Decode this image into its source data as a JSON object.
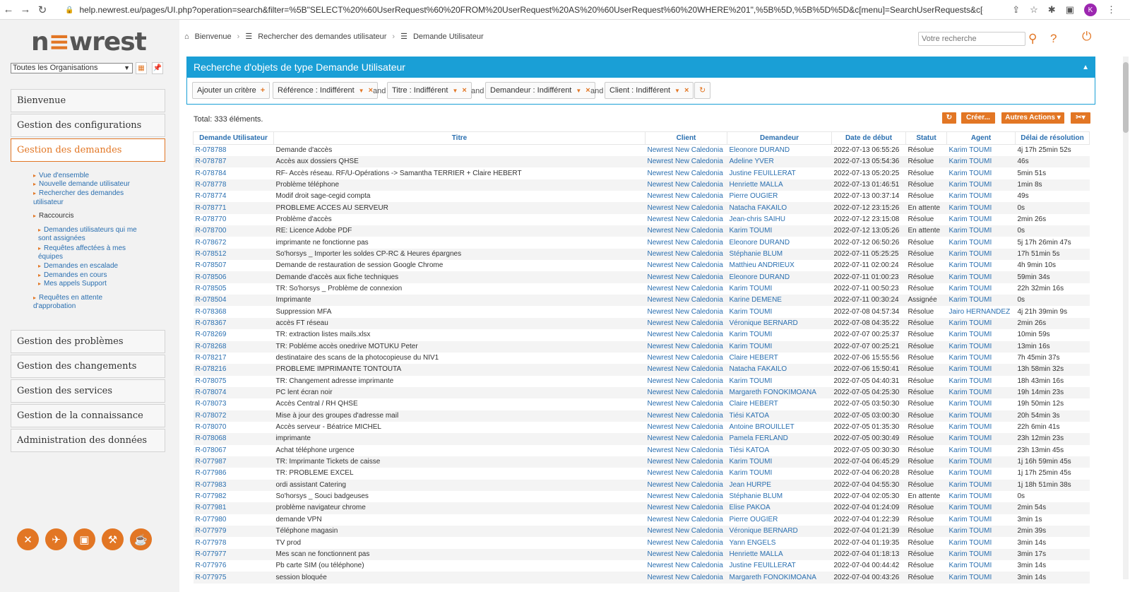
{
  "browser": {
    "url": "help.newrest.eu/pages/UI.php?operation=search&filter=%5B\"SELECT%20%60UserRequest%60%20FROM%20UserRequest%20AS%20%60UserRequest%60%20WHERE%201\",%5B%5D,%5B%5D%5D&c[menu]=SearchUserRequests&c[org_id]=",
    "avatar_letter": "K"
  },
  "logo": {
    "pre": "n",
    "e": "≡",
    "post": "wrest"
  },
  "org_select": "Toutes les Organisations",
  "sidebar": {
    "menus": [
      "Bienvenue",
      "Gestion des configurations",
      "Gestion des demandes",
      "Gestion des problèmes",
      "Gestion des changements",
      "Gestion des services",
      "Gestion de la connaissance",
      "Administration des données"
    ],
    "sub_links": [
      "Vue d'ensemble",
      "Nouvelle demande utilisateur",
      "Rechercher des demandes",
      "utilisateur",
      "Raccourcis",
      "Demandes utilisateurs qui me",
      "sont assignées",
      "Requêtes affectées à mes",
      "équipes",
      "Demandes en escalade",
      "Demandes en cours",
      "Mes appels Support",
      "Requêtes en attente",
      "d'approbation"
    ]
  },
  "breadcrumb": [
    "Bienvenue",
    "Rechercher des demandes utilisateur",
    "Demande Utilisateur"
  ],
  "search": {
    "placeholder": "Votre recherche"
  },
  "panel": {
    "title": "Recherche d'objets de type Demande Utilisateur",
    "add_criteria": "Ajouter un critère",
    "criteria": [
      "Référence : Indifférent",
      "Titre : Indifférent",
      "Demandeur : Indifférent",
      "Client : Indifférent"
    ],
    "and_word": "and"
  },
  "results": {
    "total": "Total: 333 éléments.",
    "create": "Créer...",
    "other_actions": "Autres Actions ▾",
    "columns": [
      "Demande Utilisateur",
      "Titre",
      "Client",
      "Demandeur",
      "Date de début",
      "Statut",
      "Agent",
      "Délai de résolution"
    ],
    "rows": [
      [
        "R-078788",
        "Demande d'accès",
        "Newrest New Caledonia",
        "Eleonore DURAND",
        "2022-07-13 06:55:26",
        "Résolue",
        "Karim TOUMI",
        "4j 17h 25min 52s"
      ],
      [
        "R-078787",
        "Accès aux dossiers QHSE",
        "Newrest New Caledonia",
        "Adeline YVER",
        "2022-07-13 05:54:36",
        "Résolue",
        "Karim TOUMI",
        "46s"
      ],
      [
        "R-078784",
        "RF- Accès réseau. RF/U-Opérations -> Samantha TERRIER + Claire HEBERT",
        "Newrest New Caledonia",
        "Justine FEUILLERAT",
        "2022-07-13 05:20:25",
        "Résolue",
        "Karim TOUMI",
        "5min 51s"
      ],
      [
        "R-078778",
        "Problème téléphone",
        "Newrest New Caledonia",
        "Henriette MALLA",
        "2022-07-13 01:46:51",
        "Résolue",
        "Karim TOUMI",
        "1min 8s"
      ],
      [
        "R-078774",
        "Modif droit sage-cegid compta",
        "Newrest New Caledonia",
        "Pierre OUGIER",
        "2022-07-13 00:37:14",
        "Résolue",
        "Karim TOUMI",
        "49s"
      ],
      [
        "R-078771",
        "PROBLEME ACCES AU SERVEUR",
        "Newrest New Caledonia",
        "Natacha FAKAILO",
        "2022-07-12 23:15:26",
        "En attente",
        "Karim TOUMI",
        "0s"
      ],
      [
        "R-078770",
        "Problème d'accès",
        "Newrest New Caledonia",
        "Jean-chris SAIHU",
        "2022-07-12 23:15:08",
        "Résolue",
        "Karim TOUMI",
        "2min 26s"
      ],
      [
        "R-078700",
        "RE: Licence Adobe PDF",
        "Newrest New Caledonia",
        "Karim TOUMI",
        "2022-07-12 13:05:26",
        "En attente",
        "Karim TOUMI",
        "0s"
      ],
      [
        "R-078672",
        "imprimante ne fonctionne pas",
        "Newrest New Caledonia",
        "Eleonore DURAND",
        "2022-07-12 06:50:26",
        "Résolue",
        "Karim TOUMI",
        "5j 17h 26min 47s"
      ],
      [
        "R-078512",
        "So'horsys _ Importer les soldes CP-RC & Heures épargnes",
        "Newrest New Caledonia",
        "Stéphanie BLUM",
        "2022-07-11 05:25:25",
        "Résolue",
        "Karim TOUMI",
        "17h 51min 5s"
      ],
      [
        "R-078507",
        "Demande de restauration de session Google Chrome",
        "Newrest New Caledonia",
        "Matthieu ANDRIEUX",
        "2022-07-11 02:00:24",
        "Résolue",
        "Karim TOUMI",
        "4h 9min 10s"
      ],
      [
        "R-078506",
        "Demande d'accès aux fiche techniques",
        "Newrest New Caledonia",
        "Eleonore DURAND",
        "2022-07-11 01:00:23",
        "Résolue",
        "Karim TOUMI",
        "59min 34s"
      ],
      [
        "R-078505",
        "TR: So'horsys _ Problème de connexion",
        "Newrest New Caledonia",
        "Karim TOUMI",
        "2022-07-11 00:50:23",
        "Résolue",
        "Karim TOUMI",
        "22h 32min 16s"
      ],
      [
        "R-078504",
        "Imprimante",
        "Newrest New Caledonia",
        "Karine DEMENE",
        "2022-07-11 00:30:24",
        "Assignée",
        "Karim TOUMI",
        "0s"
      ],
      [
        "R-078368",
        "Suppression MFA",
        "Newrest New Caledonia",
        "Karim TOUMI",
        "2022-07-08 04:57:34",
        "Résolue",
        "Jairo HERNANDEZ",
        "4j 21h 39min 9s"
      ],
      [
        "R-078367",
        "accès FT réseau",
        "Newrest New Caledonia",
        "Véronique BERNARD",
        "2022-07-08 04:35:22",
        "Résolue",
        "Karim TOUMI",
        "2min 26s"
      ],
      [
        "R-078269",
        "TR: extraction listes mails.xlsx",
        "Newrest New Caledonia",
        "Karim TOUMI",
        "2022-07-07 00:25:37",
        "Résolue",
        "Karim TOUMI",
        "10min 59s"
      ],
      [
        "R-078268",
        "TR: Pobléme accès onedrive MOTUKU Peter",
        "Newrest New Caledonia",
        "Karim TOUMI",
        "2022-07-07 00:25:21",
        "Résolue",
        "Karim TOUMI",
        "13min 16s"
      ],
      [
        "R-078217",
        "destinataire des scans de la photocopieuse du NIV1",
        "Newrest New Caledonia",
        "Claire HEBERT",
        "2022-07-06 15:55:56",
        "Résolue",
        "Karim TOUMI",
        "7h 45min 37s"
      ],
      [
        "R-078216",
        "PROBLEME IMPRIMANTE TONTOUTA",
        "Newrest New Caledonia",
        "Natacha FAKAILO",
        "2022-07-06 15:50:41",
        "Résolue",
        "Karim TOUMI",
        "13h 58min 32s"
      ],
      [
        "R-078075",
        "TR: Changement adresse imprimante",
        "Newrest New Caledonia",
        "Karim TOUMI",
        "2022-07-05 04:40:31",
        "Résolue",
        "Karim TOUMI",
        "18h 43min 16s"
      ],
      [
        "R-078074",
        "PC lent écran noir",
        "Newrest New Caledonia",
        "Margareth FONOKIMOANA",
        "2022-07-05 04:25:30",
        "Résolue",
        "Karim TOUMI",
        "19h 14min 23s"
      ],
      [
        "R-078073",
        "Accès Central / RH QHSE",
        "Newrest New Caledonia",
        "Claire HEBERT",
        "2022-07-05 03:50:30",
        "Résolue",
        "Karim TOUMI",
        "19h 50min 12s"
      ],
      [
        "R-078072",
        "Mise à jour des groupes d'adresse mail",
        "Newrest New Caledonia",
        "Tiési KATOA",
        "2022-07-05 03:00:30",
        "Résolue",
        "Karim TOUMI",
        "20h 54min 3s"
      ],
      [
        "R-078070",
        "Accès serveur - Béatrice MICHEL",
        "Newrest New Caledonia",
        "Antoine BROUILLET",
        "2022-07-05 01:35:30",
        "Résolue",
        "Karim TOUMI",
        "22h 6min 41s"
      ],
      [
        "R-078068",
        "imprimante",
        "Newrest New Caledonia",
        "Pamela FERLAND",
        "2022-07-05 00:30:49",
        "Résolue",
        "Karim TOUMI",
        "23h 12min 23s"
      ],
      [
        "R-078067",
        "Achat téléphone urgence",
        "Newrest New Caledonia",
        "Tiési KATOA",
        "2022-07-05 00:30:30",
        "Résolue",
        "Karim TOUMI",
        "23h 13min 45s"
      ],
      [
        "R-077987",
        "TR: Imprimante Tickets de caisse",
        "Newrest New Caledonia",
        "Karim TOUMI",
        "2022-07-04 06:45:29",
        "Résolue",
        "Karim TOUMI",
        "1j 16h 59min 45s"
      ],
      [
        "R-077986",
        "TR: PROBLEME EXCEL",
        "Newrest New Caledonia",
        "Karim TOUMI",
        "2022-07-04 06:20:28",
        "Résolue",
        "Karim TOUMI",
        "1j 17h 25min 45s"
      ],
      [
        "R-077983",
        "ordi assistant Catering",
        "Newrest New Caledonia",
        "Jean HURPE",
        "2022-07-04 04:55:30",
        "Résolue",
        "Karim TOUMI",
        "1j 18h 51min 38s"
      ],
      [
        "R-077982",
        "So'horsys _ Souci badgeuses",
        "Newrest New Caledonia",
        "Stéphanie BLUM",
        "2022-07-04 02:05:30",
        "En attente",
        "Karim TOUMI",
        "0s"
      ],
      [
        "R-077981",
        "problème navigateur chrome",
        "Newrest New Caledonia",
        "Elise PAKOA",
        "2022-07-04 01:24:09",
        "Résolue",
        "Karim TOUMI",
        "2min 54s"
      ],
      [
        "R-077980",
        "demande VPN",
        "Newrest New Caledonia",
        "Pierre OUGIER",
        "2022-07-04 01:22:39",
        "Résolue",
        "Karim TOUMI",
        "3min 1s"
      ],
      [
        "R-077979",
        "Téléphone magasin",
        "Newrest New Caledonia",
        "Véronique BERNARD",
        "2022-07-04 01:21:39",
        "Résolue",
        "Karim TOUMI",
        "2min 39s"
      ],
      [
        "R-077978",
        "TV prod",
        "Newrest New Caledonia",
        "Yann ENGELS",
        "2022-07-04 01:19:35",
        "Résolue",
        "Karim TOUMI",
        "3min 14s"
      ],
      [
        "R-077977",
        "Mes scan ne fonctionnent pas",
        "Newrest New Caledonia",
        "Henriette MALLA",
        "2022-07-04 01:18:13",
        "Résolue",
        "Karim TOUMI",
        "3min 17s"
      ],
      [
        "R-077976",
        "Pb carte SIM (ou téléphone)",
        "Newrest New Caledonia",
        "Justine FEUILLERAT",
        "2022-07-04 00:44:42",
        "Résolue",
        "Karim TOUMI",
        "3min 14s"
      ],
      [
        "R-077975",
        "session bloquée",
        "Newrest New Caledonia",
        "Margareth FONOKIMOANA",
        "2022-07-04 00:43:26",
        "Résolue",
        "Karim TOUMI",
        "3min 14s"
      ]
    ]
  }
}
